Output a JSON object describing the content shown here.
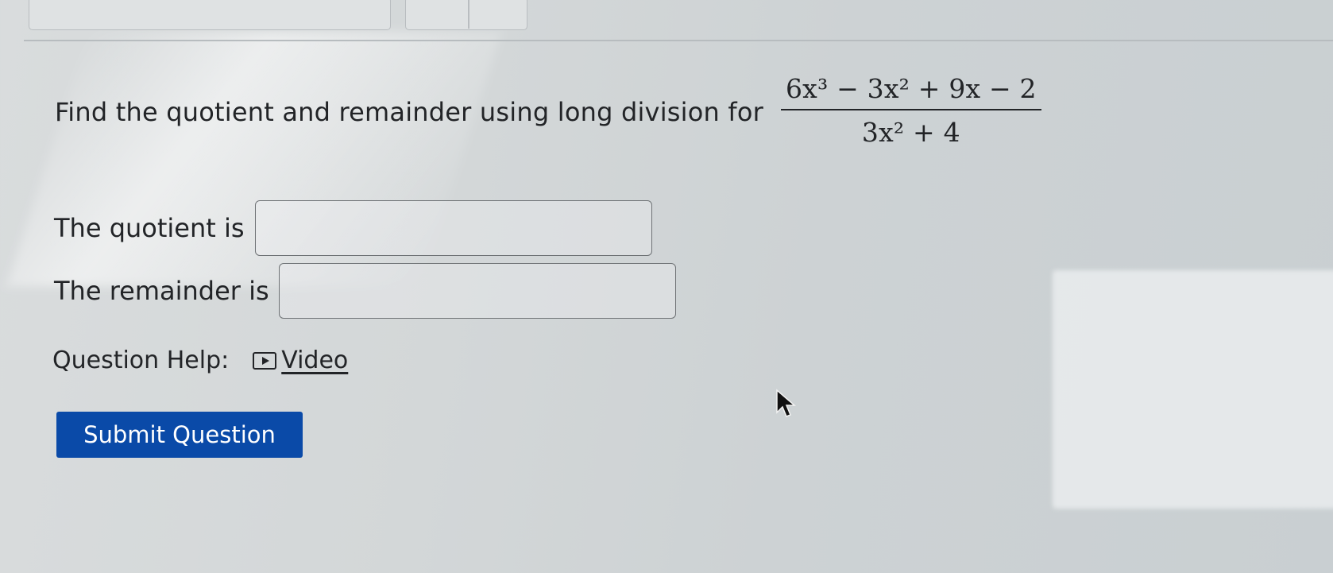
{
  "question": {
    "prompt": "Find the quotient and remainder using long division for",
    "numerator": "6x³ − 3x² + 9x − 2",
    "denominator": "3x² + 4"
  },
  "answers": {
    "quotient_label": "The quotient is",
    "quotient_value": "",
    "remainder_label": "The remainder is",
    "remainder_value": ""
  },
  "help": {
    "label": "Question Help:",
    "video_label": "Video"
  },
  "submit": {
    "label": "Submit Question",
    "color": "#0a4aa8"
  }
}
